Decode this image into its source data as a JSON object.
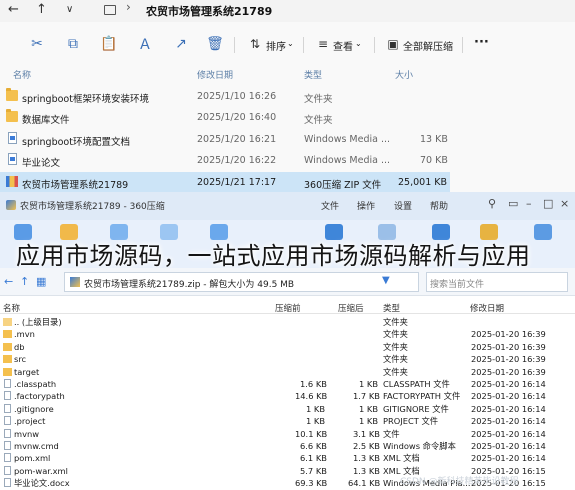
{
  "explorer": {
    "nav": {
      "back": "←",
      "up": "↑",
      "chevron": "∨"
    },
    "path_sep": "›",
    "path": "农贸市场管理系统21789",
    "toolbar": {
      "cut": "✂",
      "copy": "⧉",
      "paste": "📋",
      "rename": "Ａ",
      "share": "↗",
      "delete": "🗑",
      "sort_label": "排序",
      "view_label": "查看",
      "extract_all_label": "全部解压缩",
      "more": "···"
    },
    "columns": {
      "name": "名称",
      "date": "修改日期",
      "type": "类型",
      "size": "大小"
    },
    "files": [
      {
        "name": "springboot框架环境安装环境",
        "date": "2025/1/10 16:26",
        "type": "文件夹",
        "size": "",
        "icon": "folder"
      },
      {
        "name": "数据库文件",
        "date": "2025/1/20 16:40",
        "type": "文件夹",
        "size": "",
        "icon": "folder"
      },
      {
        "name": "springboot环境配置文档",
        "date": "2025/1/20 16:21",
        "type": "Windows Media ...",
        "size": "13 KB",
        "icon": "media"
      },
      {
        "name": "毕业论文",
        "date": "2025/1/20 16:22",
        "type": "Windows Media ...",
        "size": "70 KB",
        "icon": "media"
      },
      {
        "name": "农贸市场管理系统21789",
        "date": "2025/1/21 17:17",
        "type": "360压缩 ZIP 文件",
        "size": "25,001 KB",
        "icon": "zip"
      }
    ]
  },
  "zipwin": {
    "title": "农贸市场管理系统21789 - 360压缩",
    "menu": [
      "文件",
      "操作",
      "设置",
      "帮助"
    ],
    "path": "农贸市场管理系统21789.zip - 解包大小为 49.5 MB",
    "search_placeholder": "搜索当前文件",
    "columns": {
      "name": "名称",
      "packed": "压缩前",
      "size": "压缩后",
      "type": "类型",
      "date": "修改日期"
    },
    "rows": [
      {
        "name": ".. (上级目录)",
        "packed": "",
        "size": "",
        "type": "文件夹",
        "date": "",
        "icon": "up"
      },
      {
        "name": ".mvn",
        "packed": "",
        "size": "",
        "type": "文件夹",
        "date": "2025-01-20 16:39",
        "icon": "folder"
      },
      {
        "name": "db",
        "packed": "",
        "size": "",
        "type": "文件夹",
        "date": "2025-01-20 16:39",
        "icon": "folder"
      },
      {
        "name": "src",
        "packed": "",
        "size": "",
        "type": "文件夹",
        "date": "2025-01-20 16:39",
        "icon": "folder"
      },
      {
        "name": "target",
        "packed": "",
        "size": "",
        "type": "文件夹",
        "date": "2025-01-20 16:39",
        "icon": "folder"
      },
      {
        "name": ".classpath",
        "packed": "1.6 KB",
        "size": "1 KB",
        "type": "CLASSPATH 文件",
        "date": "2025-01-20 16:14",
        "icon": "file"
      },
      {
        "name": ".factorypath",
        "packed": "14.6 KB",
        "size": "1.7 KB",
        "type": "FACTORYPATH 文件",
        "date": "2025-01-20 16:14",
        "icon": "file"
      },
      {
        "name": ".gitignore",
        "packed": "1 KB",
        "size": "1 KB",
        "type": "GITIGNORE 文件",
        "date": "2025-01-20 16:14",
        "icon": "file"
      },
      {
        "name": ".project",
        "packed": "1 KB",
        "size": "1 KB",
        "type": "PROJECT 文件",
        "date": "2025-01-20 16:14",
        "icon": "file"
      },
      {
        "name": "mvnw",
        "packed": "10.1 KB",
        "size": "3.1 KB",
        "type": "文件",
        "date": "2025-01-20 16:14",
        "icon": "file"
      },
      {
        "name": "mvnw.cmd",
        "packed": "6.6 KB",
        "size": "2.5 KB",
        "type": "Windows 命令脚本",
        "date": "2025-01-20 16:14",
        "icon": "file"
      },
      {
        "name": "pom.xml",
        "packed": "6.1 KB",
        "size": "1.3 KB",
        "type": "XML 文档",
        "date": "2025-01-20 16:14",
        "icon": "file"
      },
      {
        "name": "pom-war.xml",
        "packed": "5.7 KB",
        "size": "1.3 KB",
        "type": "XML 文档",
        "date": "2025-01-20 16:15",
        "icon": "file"
      },
      {
        "name": "毕业论文.docx",
        "packed": "69.3 KB",
        "size": "64.1 KB",
        "type": "Windows Media Pla...",
        "date": "2025-01-20 16:15",
        "icon": "file"
      }
    ]
  },
  "caption": "应用市场源码，一站式应用市场源码解析与应用",
  "watermark": "CSDN @新科技精英毕设教程"
}
